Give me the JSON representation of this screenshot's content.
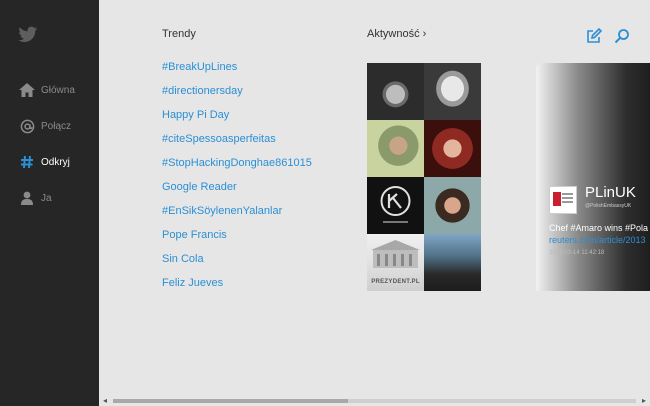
{
  "sidebar": {
    "logo": "twitter-bird-icon",
    "items": [
      {
        "label": "Główna",
        "icon": "home-icon",
        "active": false
      },
      {
        "label": "Połącz",
        "icon": "at-icon",
        "active": false
      },
      {
        "label": "Odkryj",
        "icon": "hashtag-icon",
        "active": true
      },
      {
        "label": "Ja",
        "icon": "person-icon",
        "active": false
      }
    ]
  },
  "trends": {
    "title": "Trendy",
    "items": [
      "#BreakUpLines",
      "#directionersday",
      "Happy Pi Day",
      "#citeSpessoasperfeitas",
      "#StopHackingDonghae861015",
      "Google Reader",
      "#EnSikSöylenenYalanlar",
      "Pope Francis",
      "Sin Cola",
      "Feliz Jueves"
    ]
  },
  "activity": {
    "title": "Aktywność",
    "chevron": "›",
    "tiles": [
      {
        "name": "avatar-man-glasses",
        "caption": ""
      },
      {
        "name": "avatar-man-bald",
        "caption": ""
      },
      {
        "name": "avatar-man-beard",
        "caption": ""
      },
      {
        "name": "avatar-woman-redhair",
        "caption": ""
      },
      {
        "name": "avatar-logo-circle",
        "caption": ""
      },
      {
        "name": "avatar-woman-dark",
        "caption": ""
      },
      {
        "name": "avatar-prezydent",
        "caption": "PREZYDENT.PL"
      },
      {
        "name": "avatar-man-outdoor",
        "caption": ""
      }
    ]
  },
  "toolbar": {
    "compose_icon": "compose-icon",
    "search_icon": "search-icon"
  },
  "card": {
    "name": "PLinUK",
    "handle": "@PolishEmbassyUK",
    "text": "Chef #Amaro wins #Pola",
    "link": "reuters.com/article/2013",
    "time": "2013-03-14 11:42:18"
  },
  "colors": {
    "accent": "#2b8fd6",
    "sidebar": "#262626",
    "background": "#e6e6e6"
  }
}
